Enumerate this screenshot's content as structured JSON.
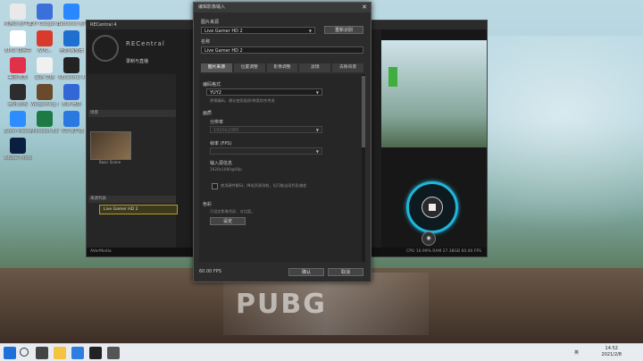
{
  "colors": {
    "accent": "#1fb6d9",
    "dialog_bg": "#2c2c2c",
    "highlight": "#b69a2a"
  },
  "desktop": {
    "icons": [
      {
        "label": "鸭游戏\n客户端",
        "color": "#e9e9e9",
        "icon": "app-icon"
      },
      {
        "label": "DIY Gadget\nbuild",
        "color": "#3b6fd9",
        "icon": "app-icon"
      },
      {
        "label": "Battlenet\n客户端",
        "color": "#2a87ff",
        "icon": "battlenet-icon"
      },
      {
        "label": "BMW\n说明书",
        "color": "#ffffff",
        "icon": "bmw-icon"
      },
      {
        "label": "WPS...",
        "color": "#d93a2b",
        "icon": "wps-icon"
      },
      {
        "label": "全能\n播放器",
        "color": "#1f6fd1",
        "icon": "app-icon"
      },
      {
        "label": "美图\n秀秀",
        "color": "#e0304a",
        "icon": "app-icon"
      },
      {
        "label": "最新\n文档",
        "color": "#f0f0f0",
        "icon": "doc-icon"
      },
      {
        "label": "RECentral\n4",
        "color": "#222222",
        "icon": "recentral-icon"
      },
      {
        "label": "腾讯\n游戏",
        "color": "#2d2d2d",
        "icon": "app-icon"
      },
      {
        "label": "Wargaming\n.net",
        "color": "#6a4a2a",
        "icon": "game-icon"
      },
      {
        "label": "天神\n竞技",
        "color": "#3367d6",
        "icon": "app-icon"
      },
      {
        "label": "Zoom\nmeeting",
        "color": "#2d8cff",
        "icon": "zoom-icon"
      },
      {
        "label": "Microsoft\nExcel",
        "color": "#1d7a45",
        "icon": "excel-icon"
      },
      {
        "label": "飞书\n客户端",
        "color": "#2a78e0",
        "icon": "feishu-icon"
      },
      {
        "label": "Adobe\nPhotoshop",
        "color": "#0a1f3f",
        "icon": "photoshop-icon"
      }
    ],
    "wallpaper_text": "PUBG"
  },
  "app": {
    "title": "RECentral 4",
    "logo": "RECentral",
    "mode": "录制与直播",
    "section_scene": "场景",
    "section_source": "来源列表",
    "scene_name": "Basic Scene",
    "source_item": "Live Gamer HD 2",
    "status_brand": "AVerMedia",
    "status_stats": "CPU 10.99%  RAM 27.38GB  60.00 FPS"
  },
  "dialog": {
    "title": "编辑影像输入",
    "device_label": "图片来源",
    "device_value": "Live Gamer HD 2",
    "refresh_button": "重新识别",
    "name_label": "名称",
    "name_value": "Live Gamer HD 2",
    "tabs": [
      "图片来源",
      "位置调整",
      "影像调整",
      "滤镜",
      "去除背景"
    ],
    "input_format_label": "编码格式",
    "input_format_value": "YUY2",
    "input_format_hint": "更换编码，建议使用画质/带宽综合考虑",
    "resolution_section": "画质",
    "resolution_label": "分辨率",
    "resolution_value": "1920x1080",
    "framerate_label": "帧率 (FPS)",
    "input_info_label": "输入源信息",
    "input_info_value": "1920x1080@60p",
    "checkbox_label": "使用硬件解码，降低资源消耗，但可能出现色彩偏差",
    "color_section": "色彩",
    "color_hint": "可设定影像色彩、对比度。",
    "color_button": "设定",
    "fps_text": "60.00 FPS",
    "ok_button": "确认",
    "cancel_button": "取消"
  },
  "taskbar": {
    "tray_text": "英",
    "time": "14:52",
    "date": "2021/2/8"
  }
}
